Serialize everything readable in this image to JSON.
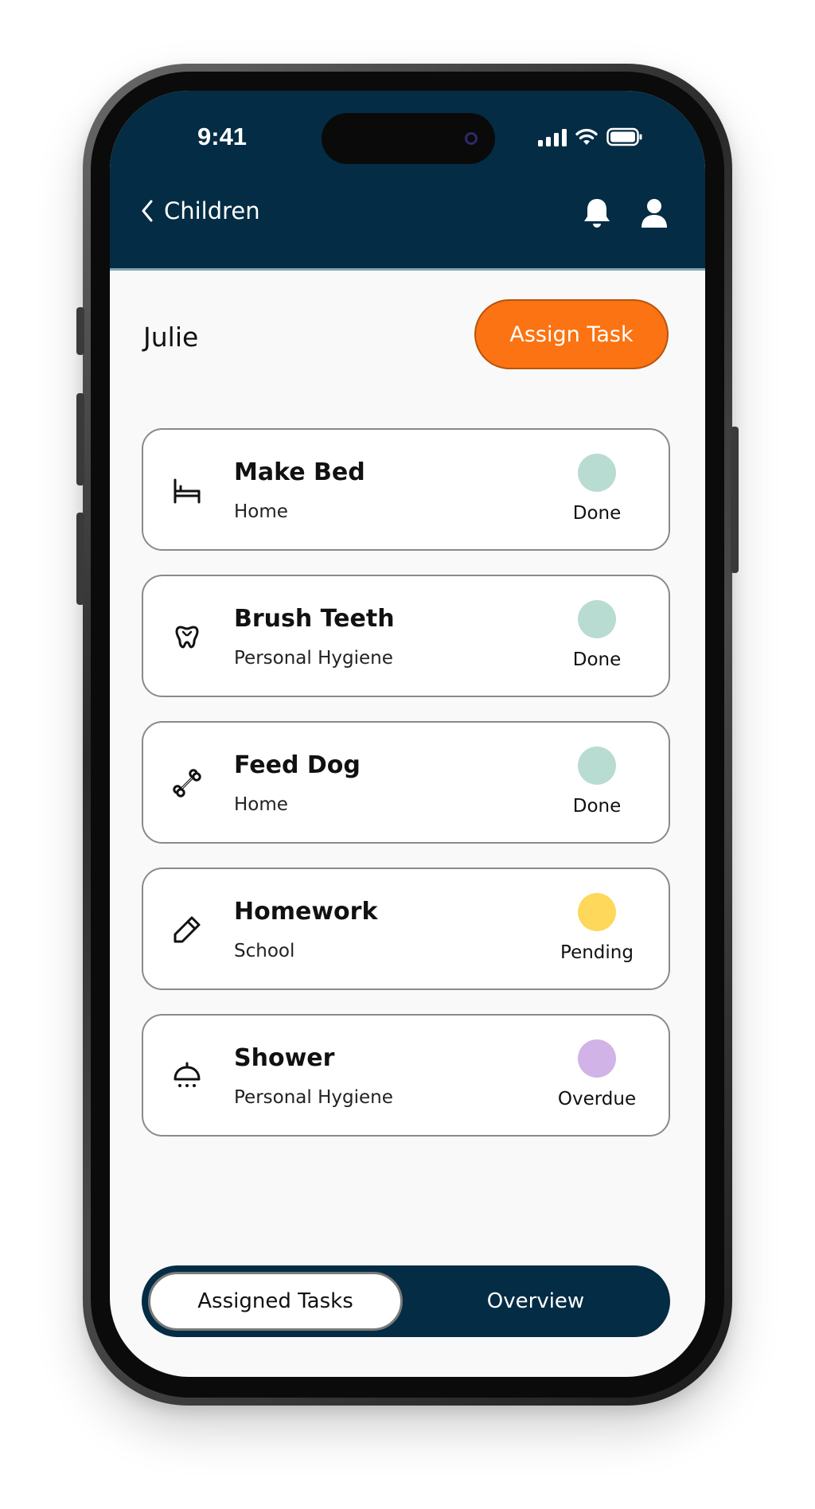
{
  "status_bar": {
    "time": "9:41",
    "icons": [
      "cellular-signal-icon",
      "wifi-icon",
      "battery-icon"
    ]
  },
  "header": {
    "back_label": "Children",
    "icons": [
      "chevron-left-icon",
      "bell-icon",
      "user-icon"
    ],
    "background": "#042c44"
  },
  "page": {
    "child_name": "Julie",
    "assign_button_label": "Assign Task",
    "accent": "#fb7312"
  },
  "tasks": [
    {
      "title": "Make Bed",
      "category": "Home",
      "status": "Done",
      "icon": "bed-icon",
      "status_color": "#b8dbd2"
    },
    {
      "title": "Brush Teeth",
      "category": "Personal Hygiene",
      "status": "Done",
      "icon": "tooth-icon",
      "status_color": "#b8dbd2"
    },
    {
      "title": "Feed Dog",
      "category": "Home",
      "status": "Done",
      "icon": "bone-icon",
      "status_color": "#b8dbd2"
    },
    {
      "title": "Homework",
      "category": "School",
      "status": "Pending",
      "icon": "pencil-icon",
      "status_color": "#fdd85a"
    },
    {
      "title": "Shower",
      "category": "Personal Hygiene",
      "status": "Overdue",
      "icon": "shower-icon",
      "status_color": "#d1b3e7"
    }
  ],
  "tabs": {
    "active": "Assigned Tasks",
    "inactive": "Overview"
  }
}
